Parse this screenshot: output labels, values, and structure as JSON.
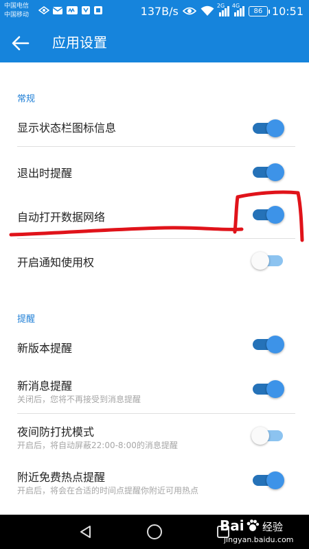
{
  "statusbar": {
    "carrier1": "中国电信",
    "carrier2": "中国移动",
    "speed": "137B/s",
    "net2g": "2G",
    "net4g": "4G",
    "battery": "86",
    "time": "10:51"
  },
  "appbar": {
    "title": "应用设置"
  },
  "sections": {
    "general": {
      "header": "常规",
      "items": [
        {
          "title": "显示状态栏图标信息",
          "enabled": true
        },
        {
          "title": "退出时提醒",
          "enabled": true
        },
        {
          "title": "自动打开数据网络",
          "enabled": true
        },
        {
          "title": "开启通知使用权",
          "enabled": false
        }
      ]
    },
    "reminders": {
      "header": "提醒",
      "items": [
        {
          "title": "新版本提醒",
          "enabled": true
        },
        {
          "title": "新消息提醒",
          "subtitle": "关闭后，您将不再接受到消息提醒",
          "enabled": true
        },
        {
          "title": "夜间防打扰模式",
          "subtitle": "开启后，将自动屏蔽22:00-8:00的消息提醒",
          "enabled": false
        },
        {
          "title": "附近免费热点提醒",
          "subtitle": "开启后，将会在合适的时间点提醒你附近可用热点",
          "enabled": true
        }
      ]
    }
  },
  "watermark": {
    "logo": "Bai",
    "text": "经验",
    "url": "jingyan.baidu.com"
  },
  "colors": {
    "primary": "#1684dc",
    "toggle_on_track": "#2572b8",
    "toggle_on_knob": "#3d93e8",
    "toggle_off_track": "#8cc3f0",
    "annotation": "#e0131a"
  }
}
